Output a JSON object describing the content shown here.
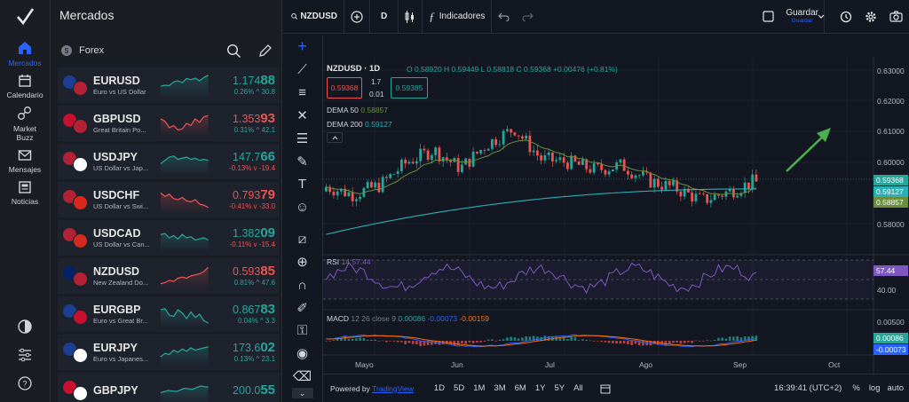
{
  "nav": {
    "items": [
      {
        "label": "Mercados",
        "icon": "home-icon",
        "active": true
      },
      {
        "label": "Calendario",
        "icon": "calendar-icon"
      },
      {
        "label": "Market Buzz",
        "icon": "buzz-icon"
      },
      {
        "label": "Mensajes",
        "icon": "mail-icon"
      },
      {
        "label": "Noticias",
        "icon": "news-icon"
      }
    ],
    "bottom_icons": [
      "theme-toggle-icon",
      "sliders-icon",
      "help-icon"
    ]
  },
  "watchlist": {
    "title": "Mercados",
    "category": "Forex",
    "rows": [
      {
        "symbol": "EURUSD",
        "desc": "Euro vs US Dollar",
        "price_main": "1.174",
        "price_small": "88",
        "change": "0.26% ^ 30.8",
        "dir": "up",
        "flags": [
          "#1c3f94",
          "#b22234"
        ],
        "spark": [
          0.55,
          0.5,
          0.52,
          0.35,
          0.3,
          0.38,
          0.2,
          0.25,
          0.18,
          0.3,
          0.15,
          0.05
        ]
      },
      {
        "symbol": "GBPUSD",
        "desc": "Great Britain Po...",
        "price_main": "1.353",
        "price_small": "93",
        "change": "0.31% ^ 42.1",
        "dir": "down",
        "flags": [
          "#c8102e",
          "#b22234"
        ],
        "spark": [
          0.3,
          0.4,
          0.7,
          0.6,
          0.8,
          0.75,
          0.5,
          0.6,
          0.3,
          0.45,
          0.2,
          0.15
        ]
      },
      {
        "symbol": "USDJPY",
        "desc": "US Dollar vs Jap...",
        "price_main": "147.7",
        "price_small": "66",
        "change": "-0.13% v -19.4",
        "dir": "up",
        "flags": [
          "#b22234",
          "#ffffff"
        ],
        "spark": [
          0.6,
          0.45,
          0.3,
          0.25,
          0.4,
          0.35,
          0.3,
          0.4,
          0.35,
          0.45,
          0.4,
          0.45
        ]
      },
      {
        "symbol": "USDCHF",
        "desc": "US Dollar vs Swi...",
        "price_main": "0.793",
        "price_small": "79",
        "change": "-0.41% v -33.0",
        "dir": "down",
        "flags": [
          "#b22234",
          "#da291c"
        ],
        "spark": [
          0.2,
          0.35,
          0.25,
          0.45,
          0.5,
          0.4,
          0.55,
          0.6,
          0.5,
          0.7,
          0.75,
          0.85
        ]
      },
      {
        "symbol": "USDCAD",
        "desc": "US Dollar vs Can...",
        "price_main": "1.382",
        "price_small": "09",
        "change": "-0.11% v -15.4",
        "dir": "up",
        "flags": [
          "#b22234",
          "#d52b1e"
        ],
        "spark": [
          0.35,
          0.3,
          0.5,
          0.4,
          0.55,
          0.35,
          0.5,
          0.45,
          0.6,
          0.55,
          0.5,
          0.6
        ]
      },
      {
        "symbol": "NZDUSD",
        "desc": "New Zealand Do...",
        "price_main": "0.593",
        "price_small": "85",
        "change": "0.81% ^ 47.6",
        "dir": "down",
        "flags": [
          "#012169",
          "#b22234"
        ],
        "spark": [
          0.85,
          0.8,
          0.7,
          0.75,
          0.6,
          0.55,
          0.6,
          0.5,
          0.45,
          0.4,
          0.3,
          0.1
        ]
      },
      {
        "symbol": "EURGBP",
        "desc": "Euro vs Great Br...",
        "price_main": "0.867",
        "price_small": "83",
        "change": "0.04% ^ 3.3",
        "dir": "up",
        "flags": [
          "#1c3f94",
          "#c8102e"
        ],
        "spark": [
          0.3,
          0.25,
          0.55,
          0.6,
          0.3,
          0.45,
          0.7,
          0.4,
          0.65,
          0.5,
          0.8,
          0.9
        ]
      },
      {
        "symbol": "EURJPY",
        "desc": "Euro vs Japanes...",
        "price_main": "173.6",
        "price_small": "02",
        "change": "0.13% ^ 23.1",
        "dir": "up",
        "flags": [
          "#1c3f94",
          "#ffffff"
        ],
        "spark": [
          0.7,
          0.55,
          0.6,
          0.4,
          0.5,
          0.35,
          0.45,
          0.3,
          0.4,
          0.35,
          0.3,
          0.25
        ]
      },
      {
        "symbol": "GBPJPY",
        "desc": "",
        "price_main": "200.0",
        "price_small": "55",
        "change": "",
        "dir": "up",
        "flags": [
          "#c8102e",
          "#ffffff"
        ],
        "spark": [
          0.6,
          0.5,
          0.55,
          0.4,
          0.45,
          0.3,
          0.35
        ]
      }
    ]
  },
  "toolbar": {
    "symbol": "NZDUSD",
    "interval": "D",
    "indicators": "Indicadores",
    "save_label": "Guardar",
    "save_sub": "Guardar"
  },
  "legend": {
    "title": "NZDUSD · 1D",
    "ohlc": "O 0.58920 H 0.59449 L 0.58818 C 0.59368 +0.00476 (+0.81%)",
    "sell": "0.59368",
    "spread": "1.7",
    "spread2": "0.01",
    "buy": "0.59385",
    "dema50_label": "DEMA 50",
    "dema50": "0.58857",
    "dema200_label": "DEMA 200",
    "dema200": "0.59127",
    "rsi_label": "RSI",
    "rsi_len": "14",
    "rsi_val": "57.44",
    "macd_label": "MACD",
    "macd_params": "12 26 close 9",
    "macd_v1": "0.00086",
    "macd_v2": "-0.00073",
    "macd_v3": "-0.00159"
  },
  "price_axis": {
    "ticks": [
      "0.63000",
      "0.62000",
      "0.61000",
      "0.60000",
      "0.58000"
    ],
    "tag_close": "0.59368",
    "tag_dema200": "0.59127",
    "tag_dema50": "0.58857",
    "rsi_tag": "57.44",
    "rsi_tick": "40.00",
    "macd_tick": "0.00500",
    "macd_tag1": "0.00086",
    "macd_tag2": "-0.00073"
  },
  "time_axis": [
    "Mayo",
    "Jun",
    "Jul",
    "Ago",
    "Sep",
    "Oct"
  ],
  "bottom": {
    "powered": "Powered by",
    "brand": "TradingView",
    "ranges": [
      "1D",
      "5D",
      "1M",
      "3M",
      "6M",
      "1Y",
      "5Y",
      "All"
    ],
    "clock": "16:39:41 (UTC+2)",
    "pct": "%",
    "log": "log",
    "auto": "auto"
  },
  "colors": {
    "up": "#26a69a",
    "down": "#ef5350",
    "accent": "#2962ff",
    "arrow": "#4caf50"
  }
}
